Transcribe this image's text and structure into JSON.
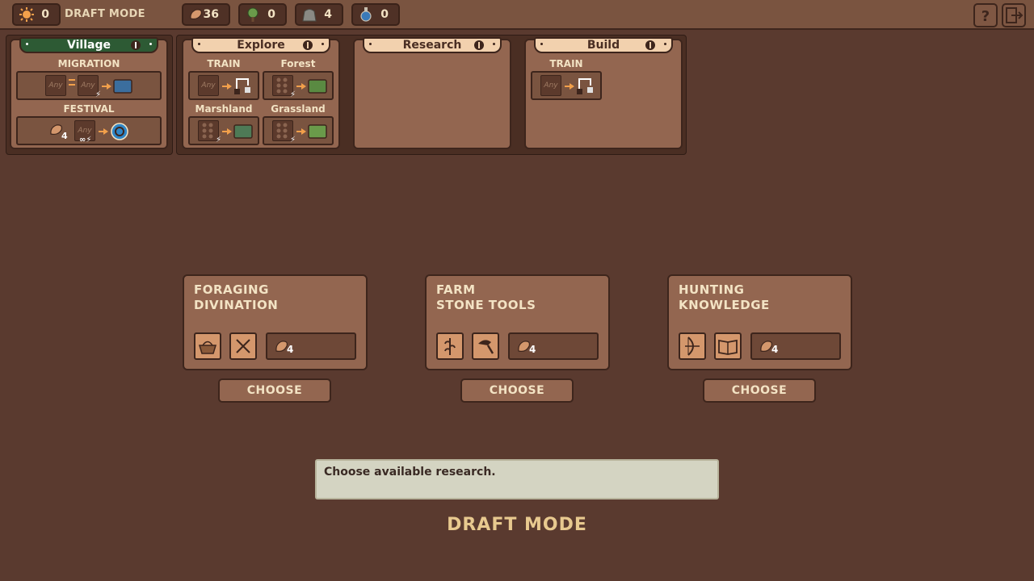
{
  "topbar": {
    "mode_label": "DRAFT MODE",
    "resources": [
      {
        "name": "sun",
        "value": "0"
      },
      {
        "name": "food",
        "value": "36"
      },
      {
        "name": "wood",
        "value": "0"
      },
      {
        "name": "stone",
        "value": "4"
      },
      {
        "name": "potion",
        "value": "0"
      }
    ]
  },
  "panels": {
    "village": {
      "title": "Village",
      "actions": [
        {
          "label": "MIGRATION",
          "slot1": "Any",
          "slot2": "Any"
        },
        {
          "label": "FESTIVAL",
          "slot": "Any",
          "cost": "4"
        }
      ]
    },
    "explore": {
      "title": "Explore",
      "actions": [
        {
          "label": "TRAIN",
          "slot": "Any"
        },
        {
          "label": "Forest"
        },
        {
          "label": "Marshland"
        },
        {
          "label": "Grassland"
        }
      ]
    },
    "research": {
      "title": "Research"
    },
    "build": {
      "title": "Build",
      "actions": [
        {
          "label": "TRAIN",
          "slot": "Any"
        }
      ]
    }
  },
  "choices": [
    {
      "line1": "FORAGING",
      "line2": "DIVINATION",
      "cost": "4",
      "icons": [
        "basket-icon",
        "crossed-tools-icon"
      ],
      "button": "CHOOSE"
    },
    {
      "line1": "FARM",
      "line2": "STONE TOOLS",
      "cost": "4",
      "icons": [
        "wheat-icon",
        "stone-axe-icon"
      ],
      "button": "CHOOSE"
    },
    {
      "line1": "HUNTING",
      "line2": "KNOWLEDGE",
      "cost": "4",
      "icons": [
        "bow-icon",
        "book-icon"
      ],
      "button": "CHOOSE"
    }
  ],
  "message": "Choose available research.",
  "bottom_mode": "DRAFT MODE",
  "colors": {
    "background": "#5a3a2f",
    "card": "#936650",
    "village_tab": "#2d5a34",
    "tab": "#f2d1ae"
  }
}
